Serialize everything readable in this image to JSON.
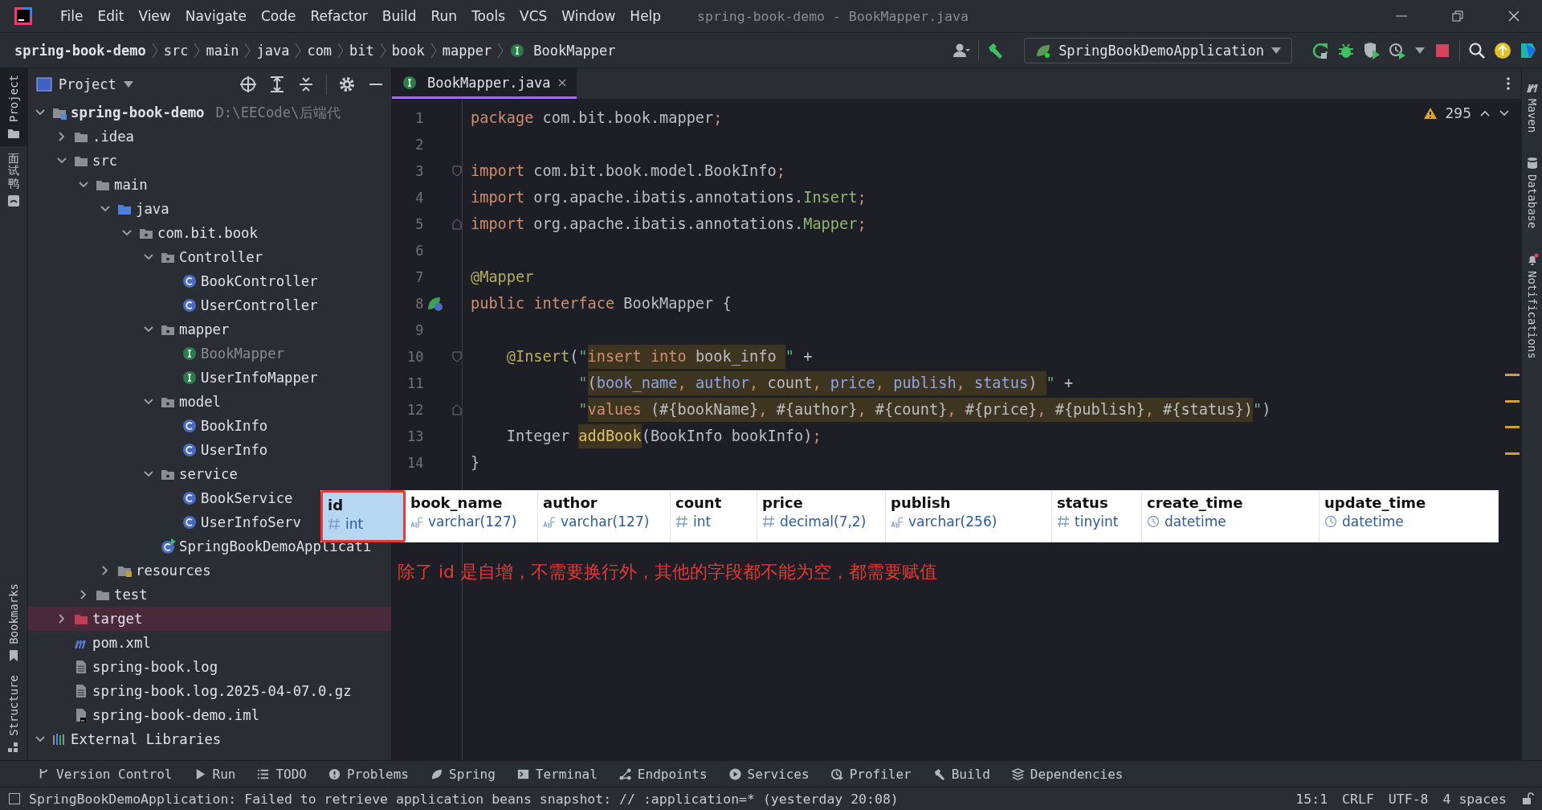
{
  "menu": [
    "File",
    "Edit",
    "View",
    "Navigate",
    "Code",
    "Refactor",
    "Build",
    "Run",
    "Tools",
    "VCS",
    "Window",
    "Help"
  ],
  "window": {
    "title": "spring-book-demo - BookMapper.java"
  },
  "breadcrumbs": [
    {
      "label": "spring-book-demo",
      "kind": "project"
    },
    {
      "label": "src",
      "kind": "dir"
    },
    {
      "label": "main",
      "kind": "dir"
    },
    {
      "label": "java",
      "kind": "dir"
    },
    {
      "label": "com",
      "kind": "dir"
    },
    {
      "label": "bit",
      "kind": "dir"
    },
    {
      "label": "book",
      "kind": "dir"
    },
    {
      "label": "mapper",
      "kind": "dir"
    },
    {
      "label": "BookMapper",
      "kind": "interface"
    }
  ],
  "run_config": {
    "label": "SpringBookDemoApplication"
  },
  "left_strip": {
    "top": [
      {
        "label": "Project",
        "kind": "project",
        "selected": true
      },
      {
        "label": "面试鸭",
        "kind": "plugin",
        "selected": false
      }
    ],
    "bottom": [
      {
        "label": "Bookmarks",
        "kind": "bookmarks",
        "selected": false
      },
      {
        "label": "Structure",
        "kind": "structure",
        "selected": false
      }
    ]
  },
  "right_strip": [
    {
      "label": "Maven",
      "kind": "maven"
    },
    {
      "label": "Database",
      "kind": "database"
    },
    {
      "label": "Notifications",
      "kind": "bell"
    }
  ],
  "project": {
    "title": "Project",
    "tree": [
      {
        "label": "spring-book-demo",
        "kind": "module",
        "path": "D:\\EECode\\后端代",
        "expanded": true,
        "children": [
          {
            "label": ".idea",
            "kind": "folder",
            "expanded": false
          },
          {
            "label": "src",
            "kind": "folder",
            "expanded": true,
            "children": [
              {
                "label": "main",
                "kind": "folder",
                "expanded": true,
                "children": [
                  {
                    "label": "java",
                    "kind": "source",
                    "expanded": true,
                    "children": [
                      {
                        "label": "com.bit.book",
                        "kind": "package",
                        "expanded": true,
                        "children": [
                          {
                            "label": "Controller",
                            "kind": "package",
                            "expanded": true,
                            "children": [
                              {
                                "label": "BookController",
                                "kind": "class"
                              },
                              {
                                "label": "UserController",
                                "kind": "class"
                              }
                            ]
                          },
                          {
                            "label": "mapper",
                            "kind": "package",
                            "expanded": true,
                            "children": [
                              {
                                "label": "BookMapper",
                                "kind": "interface",
                                "dimmed": true
                              },
                              {
                                "label": "UserInfoMapper",
                                "kind": "interface"
                              }
                            ]
                          },
                          {
                            "label": "model",
                            "kind": "package",
                            "expanded": true,
                            "children": [
                              {
                                "label": "BookInfo",
                                "kind": "class"
                              },
                              {
                                "label": "UserInfo",
                                "kind": "class"
                              }
                            ]
                          },
                          {
                            "label": "service",
                            "kind": "package",
                            "expanded": true,
                            "children": [
                              {
                                "label": "BookService",
                                "kind": "class"
                              },
                              {
                                "label": "UserInfoServ",
                                "kind": "class"
                              }
                            ]
                          },
                          {
                            "label": "SpringBookDemoApplicati",
                            "kind": "app"
                          }
                        ]
                      }
                    ]
                  },
                  {
                    "label": "resources",
                    "kind": "resources",
                    "expanded": false
                  }
                ]
              },
              {
                "label": "test",
                "kind": "folder",
                "expanded": false
              }
            ]
          },
          {
            "label": "target",
            "kind": "excluded",
            "expanded": false
          },
          {
            "label": "pom.xml",
            "kind": "maven"
          },
          {
            "label": "spring-book.log",
            "kind": "log"
          },
          {
            "label": "spring-book.log.2025-04-07.0.gz",
            "kind": "log"
          },
          {
            "label": "spring-book-demo.iml",
            "kind": "iml"
          }
        ]
      },
      {
        "label": "External Libraries",
        "kind": "libraries",
        "expanded": true
      }
    ]
  },
  "tabs": [
    {
      "label": "BookMapper.java",
      "kind": "interface",
      "selected": true
    }
  ],
  "inspections": {
    "warnings": "295"
  },
  "code": [
    {
      "num": "1",
      "tokens": [
        {
          "t": "package",
          "kind": "kw"
        },
        {
          "t": " com.bit.book.mapper",
          "kind": "plain"
        },
        {
          "t": ";",
          "kind": "kw"
        }
      ]
    },
    {
      "num": "2"
    },
    {
      "num": "3",
      "kind": "fold",
      "tokens": [
        {
          "t": "import",
          "kind": "kw"
        },
        {
          "t": " com.bit.book.model.BookInfo",
          "kind": "plain"
        },
        {
          "t": ";",
          "kind": "kw"
        }
      ]
    },
    {
      "num": "4",
      "tokens": [
        {
          "t": "import",
          "kind": "kw"
        },
        {
          "t": " org.apache.ibatis.annotations.",
          "kind": "plain"
        },
        {
          "t": "Insert",
          "kind": "type"
        },
        {
          "t": ";",
          "kind": "kw"
        }
      ]
    },
    {
      "num": "5",
      "kind": "fold-end",
      "tokens": [
        {
          "t": "import",
          "kind": "kw"
        },
        {
          "t": " org.apache.ibatis.annotations.",
          "kind": "plain"
        },
        {
          "t": "Mapper",
          "kind": "type"
        },
        {
          "t": ";",
          "kind": "kw"
        }
      ]
    },
    {
      "num": "6"
    },
    {
      "num": "7",
      "tokens": [
        {
          "t": "@Mapper",
          "kind": "ann"
        }
      ]
    },
    {
      "num": "8",
      "kind": "impl",
      "tokens": [
        {
          "t": "public ",
          "kind": "kw"
        },
        {
          "t": "interface",
          "kind": "kw"
        },
        {
          "t": " BookMapper {",
          "kind": "plain"
        }
      ]
    },
    {
      "num": "9"
    },
    {
      "num": "10",
      "kind": "fold",
      "tokens": [
        {
          "t": "    @Insert",
          "kind": "ann"
        },
        {
          "t": "(",
          "kind": "plain"
        },
        {
          "t": "\"",
          "kind": "str"
        },
        {
          "t": "insert",
          "kind": "kw",
          "hl": true
        },
        {
          "t": " into",
          "kind": "kw",
          "hl": true
        },
        {
          "t": " book_info ",
          "kind": "plain",
          "hl": true
        },
        {
          "t": "\"",
          "kind": "str"
        },
        {
          "t": " +",
          "kind": "plain"
        }
      ]
    },
    {
      "num": "11",
      "tokens": [
        {
          "t": "            \"",
          "kind": "str"
        },
        {
          "t": "(",
          "kind": "plain",
          "hl": true
        },
        {
          "t": "book_name",
          "kind": "col",
          "hl": true
        },
        {
          "t": ",",
          "kind": "kw",
          "hl": true
        },
        {
          "t": " author",
          "kind": "col",
          "hl": true
        },
        {
          "t": ",",
          "kind": "kw",
          "hl": true
        },
        {
          "t": " count",
          "kind": "plain",
          "hl": true
        },
        {
          "t": ",",
          "kind": "kw",
          "hl": true
        },
        {
          "t": " price",
          "kind": "col",
          "hl": true
        },
        {
          "t": ",",
          "kind": "kw",
          "hl": true
        },
        {
          "t": " publish",
          "kind": "col",
          "hl": true
        },
        {
          "t": ",",
          "kind": "kw",
          "hl": true
        },
        {
          "t": " status",
          "kind": "col",
          "hl": true
        },
        {
          "t": ") ",
          "kind": "plain",
          "hl": true
        },
        {
          "t": "\"",
          "kind": "str"
        },
        {
          "t": " +",
          "kind": "plain"
        }
      ]
    },
    {
      "num": "12",
      "kind": "fold-end",
      "tokens": [
        {
          "t": "            \"",
          "kind": "str"
        },
        {
          "t": "values",
          "kind": "kw",
          "hl": true
        },
        {
          "t": " (#{bookName}",
          "kind": "plain",
          "hl": true
        },
        {
          "t": ",",
          "kind": "kw",
          "hl": true
        },
        {
          "t": " #{author}",
          "kind": "plain",
          "hl": true
        },
        {
          "t": ",",
          "kind": "kw",
          "hl": true
        },
        {
          "t": " #{count}",
          "kind": "plain",
          "hl": true
        },
        {
          "t": ",",
          "kind": "kw",
          "hl": true
        },
        {
          "t": " #{price}",
          "kind": "plain",
          "hl": true
        },
        {
          "t": ",",
          "kind": "kw",
          "hl": true
        },
        {
          "t": " #{publish}",
          "kind": "plain",
          "hl": true
        },
        {
          "t": ",",
          "kind": "kw",
          "hl": true
        },
        {
          "t": " #{status})",
          "kind": "plain",
          "hl": true
        },
        {
          "t": "\"",
          "kind": "str"
        },
        {
          "t": ")",
          "kind": "plain"
        }
      ]
    },
    {
      "num": "13",
      "tokens": [
        {
          "t": "    Integer ",
          "kind": "plain"
        },
        {
          "t": "addBook",
          "kind": "fn",
          "hl": true
        },
        {
          "t": "(BookInfo bookInfo)",
          "kind": "plain"
        },
        {
          "t": ";",
          "kind": "kw"
        }
      ]
    },
    {
      "num": "14",
      "tokens": [
        {
          "t": "}",
          "kind": "plain"
        }
      ]
    }
  ],
  "table_snapshot": {
    "columns": [
      {
        "name": "id",
        "type": "int",
        "kind": "number",
        "selected": true
      },
      {
        "name": "book_name",
        "type": "varchar(127)",
        "kind": "text",
        "selected": false
      },
      {
        "name": "author",
        "type": "varchar(127)",
        "kind": "text",
        "selected": false
      },
      {
        "name": "count",
        "type": "int",
        "kind": "number",
        "selected": false
      },
      {
        "name": "price",
        "type": "decimal(7,2)",
        "kind": "number",
        "selected": false
      },
      {
        "name": "publish",
        "type": "varchar(256)",
        "kind": "text",
        "selected": false
      },
      {
        "name": "status",
        "type": "tinyint",
        "kind": "number",
        "selected": false
      },
      {
        "name": "create_time",
        "type": "datetime",
        "kind": "time",
        "selected": false
      },
      {
        "name": "update_time",
        "type": "datetime",
        "kind": "time",
        "selected": false
      }
    ]
  },
  "annotation": "除了 id 是自增，不需要换行外，其他的字段都不能为空，都需要赋值",
  "tool_windows": [
    {
      "label": "Version Control",
      "kind": "vcs"
    },
    {
      "label": "Run",
      "kind": "run"
    },
    {
      "label": "TODO",
      "kind": "todo"
    },
    {
      "label": "Problems",
      "kind": "problems"
    },
    {
      "label": "Spring",
      "kind": "spring"
    },
    {
      "label": "Terminal",
      "kind": "terminal"
    },
    {
      "label": "Endpoints",
      "kind": "endpoints"
    },
    {
      "label": "Services",
      "kind": "services"
    },
    {
      "label": "Profiler",
      "kind": "profiler"
    },
    {
      "label": "Build",
      "kind": "build"
    },
    {
      "label": "Dependencies",
      "kind": "deps"
    }
  ],
  "status_bar": {
    "message": "SpringBookDemoApplication: Failed to retrieve application beans snapshot: // :application=* (yesterday 20:08)",
    "items": [
      "15:1",
      "CRLF",
      "UTF-8",
      "4 spaces"
    ]
  }
}
